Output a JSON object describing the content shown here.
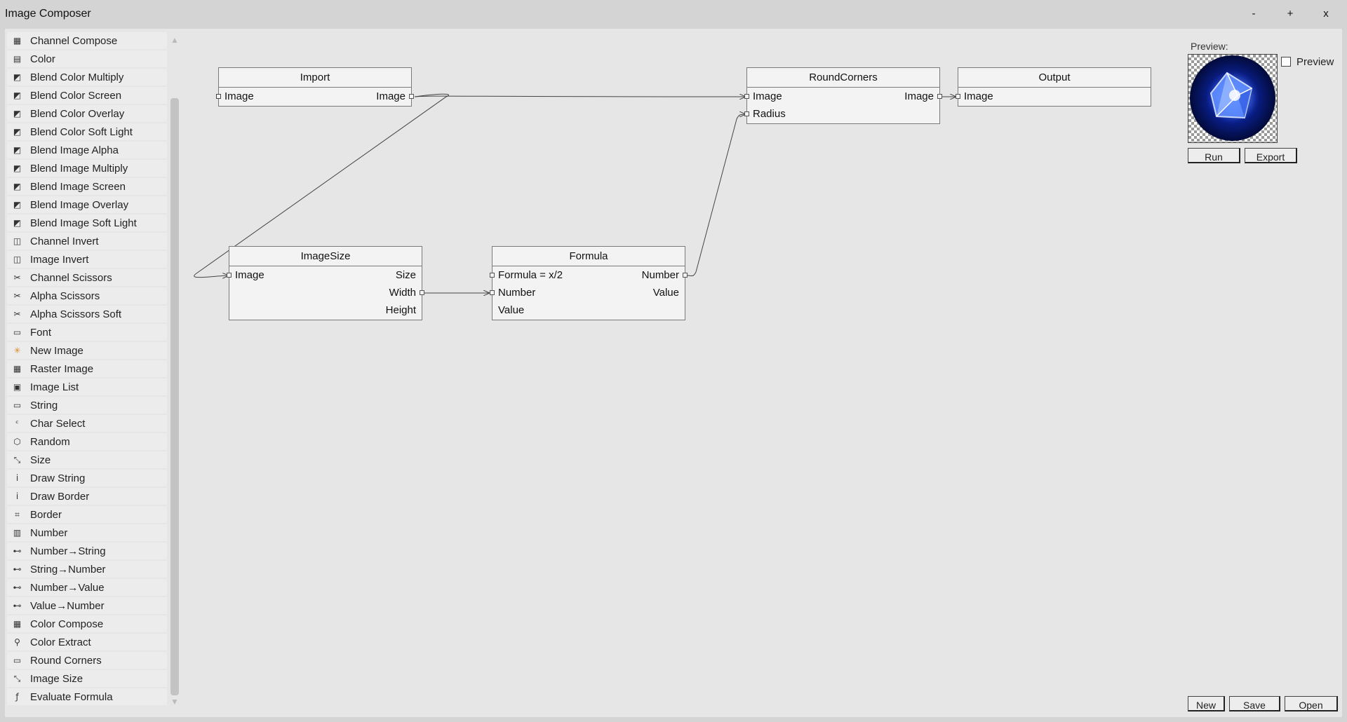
{
  "window": {
    "title": "Image Composer",
    "minimize": "-",
    "maximize": "+",
    "close": "x"
  },
  "sidebar": {
    "items": [
      {
        "label": "Channel Compose",
        "icon": "channel-compose-icon",
        "glyph": "▦"
      },
      {
        "label": "Color",
        "icon": "color-icon",
        "glyph": "▤"
      },
      {
        "label": "Blend Color Multiply",
        "icon": "blend-icon",
        "glyph": "◩"
      },
      {
        "label": "Blend Color Screen",
        "icon": "blend-icon",
        "glyph": "◩"
      },
      {
        "label": "Blend Color Overlay",
        "icon": "blend-icon",
        "glyph": "◩"
      },
      {
        "label": "Blend Color Soft Light",
        "icon": "blend-icon",
        "glyph": "◩"
      },
      {
        "label": "Blend Image Alpha",
        "icon": "blend-icon",
        "glyph": "◩"
      },
      {
        "label": "Blend Image Multiply",
        "icon": "blend-icon",
        "glyph": "◩"
      },
      {
        "label": "Blend Image Screen",
        "icon": "blend-icon",
        "glyph": "◩"
      },
      {
        "label": "Blend Image Overlay",
        "icon": "blend-icon",
        "glyph": "◩"
      },
      {
        "label": "Blend Image Soft Light",
        "icon": "blend-icon",
        "glyph": "◩"
      },
      {
        "label": "Channel Invert",
        "icon": "invert-icon",
        "glyph": "◫"
      },
      {
        "label": "Image Invert",
        "icon": "invert-icon",
        "glyph": "◫"
      },
      {
        "label": "Channel Scissors",
        "icon": "scissors-icon",
        "glyph": "✂"
      },
      {
        "label": "Alpha Scissors",
        "icon": "scissors-icon",
        "glyph": "✂"
      },
      {
        "label": "Alpha Scissors Soft",
        "icon": "scissors-icon",
        "glyph": "✂"
      },
      {
        "label": "Font",
        "icon": "font-icon",
        "glyph": "▭"
      },
      {
        "label": "New Image",
        "icon": "new-image-icon",
        "glyph": "✳"
      },
      {
        "label": "Raster Image",
        "icon": "raster-icon",
        "glyph": "▦"
      },
      {
        "label": "Image List",
        "icon": "image-list-icon",
        "glyph": "▣"
      },
      {
        "label": "String",
        "icon": "string-icon",
        "glyph": "▭"
      },
      {
        "label": "Char Select",
        "icon": "char-icon",
        "glyph": "ᶜ"
      },
      {
        "label": "Random",
        "icon": "random-icon",
        "glyph": "⬡"
      },
      {
        "label": "Size",
        "icon": "size-icon",
        "glyph": "⤡"
      },
      {
        "label": "Draw String",
        "icon": "draw-string-icon",
        "glyph": "ⅰ"
      },
      {
        "label": "Draw Border",
        "icon": "draw-border-icon",
        "glyph": "ⅰ"
      },
      {
        "label": "Border",
        "icon": "border-icon",
        "glyph": "⌗"
      },
      {
        "label": "Number",
        "icon": "number-icon",
        "glyph": "▥"
      },
      {
        "label": "Number→String",
        "icon": "convert-icon",
        "glyph": "⊷"
      },
      {
        "label": "String→Number",
        "icon": "convert-icon",
        "glyph": "⊷"
      },
      {
        "label": "Number→Value",
        "icon": "convert-icon",
        "glyph": "⊷"
      },
      {
        "label": "Value→Number",
        "icon": "convert-icon",
        "glyph": "⊷"
      },
      {
        "label": "Color Compose",
        "icon": "color-compose-icon",
        "glyph": "▦"
      },
      {
        "label": "Color Extract",
        "icon": "color-extract-icon",
        "glyph": "⚲"
      },
      {
        "label": "Round Corners",
        "icon": "round-corners-icon",
        "glyph": "▭"
      },
      {
        "label": "Image Size",
        "icon": "image-size-icon",
        "glyph": "⤡"
      },
      {
        "label": "Evaluate Formula",
        "icon": "formula-icon",
        "glyph": "ƒ"
      }
    ],
    "scroll_up": "▲",
    "scroll_down": "▼"
  },
  "nodes": {
    "import": {
      "title": "Import",
      "in": "Image",
      "out": "Image"
    },
    "imagesize": {
      "title": "ImageSize",
      "in": "Image",
      "out1": "Size",
      "out2": "Width",
      "out3": "Height"
    },
    "formula": {
      "title": "Formula",
      "in1": "Formula = x/2",
      "in2": "Number",
      "in3": "Value",
      "out1": "Number",
      "out2": "Value"
    },
    "roundcorners": {
      "title": "RoundCorners",
      "in1": "Image",
      "in2": "Radius",
      "out": "Image"
    },
    "output": {
      "title": "Output",
      "in": "Image"
    }
  },
  "preview": {
    "label": "Preview:",
    "checkbox_label": "Preview",
    "checkbox_checked": false
  },
  "buttons": {
    "run": "Run",
    "export": "Export",
    "new": "New",
    "save": "Save",
    "open": "Open"
  },
  "colors": {
    "background": "#d4d4d4",
    "panel": "#e6e6e6",
    "node": "#f3f3f3",
    "accent_preview": "#2a5bff"
  }
}
